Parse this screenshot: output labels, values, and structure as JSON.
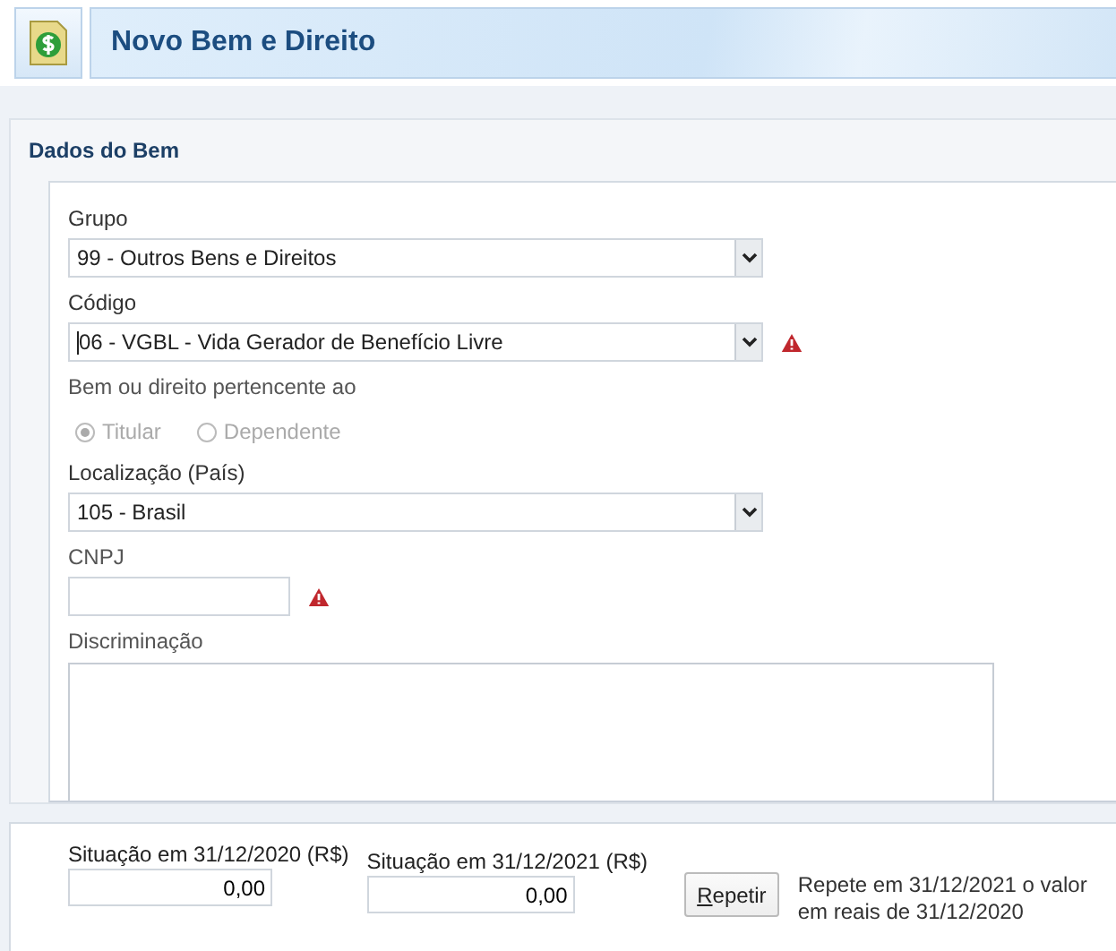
{
  "header": {
    "title": "Novo Bem e Direito"
  },
  "section": {
    "title": "Dados do Bem"
  },
  "fields": [
    {
      "kind": "select",
      "label": "Grupo",
      "value": "99 - Outros Bens e Direitos",
      "warning": false,
      "focused": false
    },
    {
      "kind": "select",
      "label": "Código",
      "value": "06 - VGBL - Vida Gerador de Benefício Livre",
      "warning": true,
      "focused": true
    },
    {
      "kind": "radio",
      "label": "Bem ou direito pertencente ao",
      "options": [
        {
          "label": "Titular",
          "selected": true,
          "disabled": true
        },
        {
          "label": "Dependente",
          "selected": false,
          "disabled": true
        }
      ]
    },
    {
      "kind": "select",
      "label": "Localização (País)",
      "value": "105 - Brasil",
      "warning": false,
      "focused": false
    },
    {
      "kind": "text",
      "label": "CNPJ",
      "warning": true
    },
    {
      "kind": "textarea",
      "label": "Discriminação"
    }
  ],
  "values": [
    {
      "label": "Situação em 31/12/2020 (R$)",
      "value": "0,00"
    },
    {
      "label": "Situação em 31/12/2021 (R$)",
      "value": "0,00"
    }
  ],
  "repeat_button": {
    "label": "Repetir"
  },
  "repeat_note": "Repete em 31/12/2021 o valor em reais de 31/12/2020"
}
